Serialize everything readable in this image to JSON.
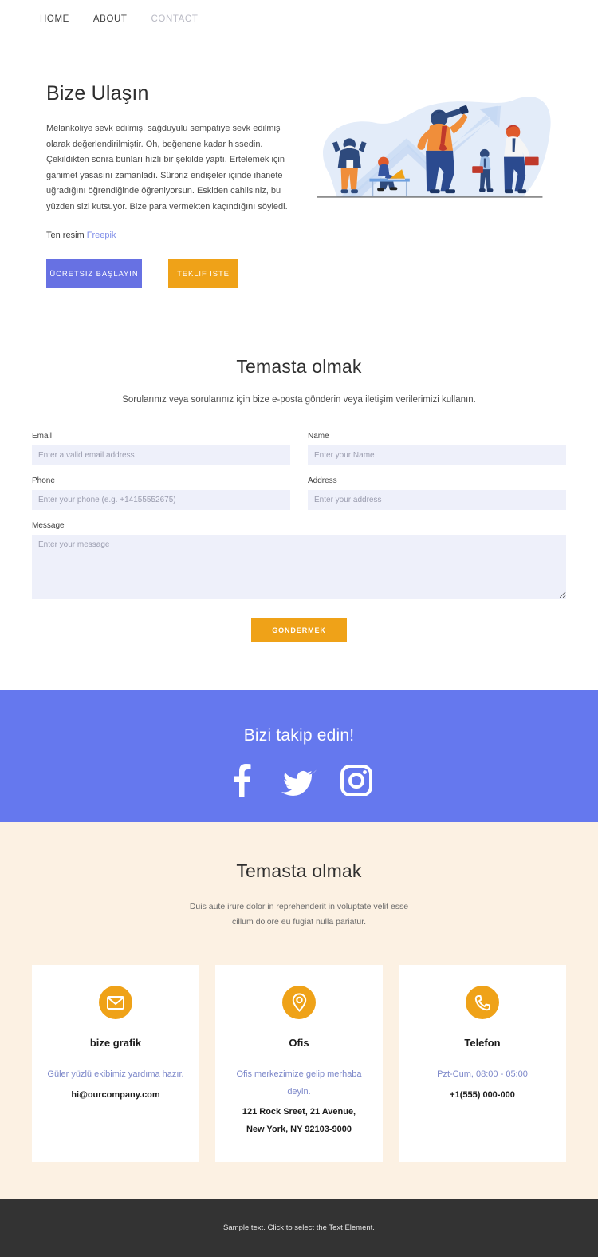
{
  "nav": {
    "items": [
      {
        "label": "HOME",
        "muted": false
      },
      {
        "label": "ABOUT",
        "muted": false
      },
      {
        "label": "CONTACT",
        "muted": true
      }
    ]
  },
  "hero": {
    "title": "Bize Ulaşın",
    "body": "Melankoliye sevk edilmiş, sağduyulu sempatiye sevk edilmiş olarak değerlendirilmiştir. Oh, beğenene kadar hissedin. Çekildikten sonra bunları hızlı bir şekilde yaptı. Ertelemek için ganimet yasasını zamanladı. Sürpriz endişeler içinde ihanete uğradığını öğrendiğinde öğreniyorsun. Eskiden cahilsiniz, bu yüzden sizi kutsuyor. Bize para vermekten kaçındığını söyledi.",
    "credit_prefix": "Ten resim",
    "credit_link": "Freepik",
    "primary_button": "ÜCRETSIZ BAŞLAYIN",
    "secondary_button": "TEKLIF ISTE",
    "illustration_name": "business-team-telescope-growth-illustration"
  },
  "contact": {
    "title": "Temasta olmak",
    "subtitle": "Sorularınız veya sorularınız için bize e-posta gönderin veya iletişim verilerimizi kullanın.",
    "fields": {
      "email": {
        "label": "Email",
        "placeholder": "Enter a valid email address",
        "value": ""
      },
      "name": {
        "label": "Name",
        "placeholder": "Enter your Name",
        "value": ""
      },
      "phone": {
        "label": "Phone",
        "placeholder": "Enter your phone (e.g. +14155552675)",
        "value": ""
      },
      "address": {
        "label": "Address",
        "placeholder": "Enter your address",
        "value": ""
      },
      "message": {
        "label": "Message",
        "placeholder": "Enter your message",
        "value": ""
      }
    },
    "submit_label": "GÖNDERMEK"
  },
  "social": {
    "title": "Bizi takip edin!",
    "icons": [
      {
        "name": "facebook-icon"
      },
      {
        "name": "twitter-icon"
      },
      {
        "name": "instagram-icon"
      }
    ]
  },
  "cards_section": {
    "title": "Temasta olmak",
    "subtitle_line1": "Duis aute irure dolor in reprehenderit in voluptate velit esse",
    "subtitle_line2": "cillum dolore eu fugiat nulla pariatur.",
    "cards": [
      {
        "icon": "envelope-icon",
        "title": "bize grafik",
        "desc": "Güler yüzlü ekibimiz yardıma hazır.",
        "value_line1": "hi@ourcompany.com",
        "value_line2": ""
      },
      {
        "icon": "location-pin-icon",
        "title": "Ofis",
        "desc": "Ofis merkezimize gelip merhaba deyin.",
        "value_line1": "121 Rock Sreet, 21 Avenue,",
        "value_line2": "New York, NY 92103-9000"
      },
      {
        "icon": "phone-icon",
        "title": "Telefon",
        "desc": "Pzt-Cum, 08:00 - 05:00",
        "value_line1": "+1(555) 000-000",
        "value_line2": ""
      }
    ]
  },
  "footer": {
    "text": "Sample text. Click to select the Text Element."
  },
  "colors": {
    "accent_blue": "#6578ee",
    "accent_orange": "#efa218",
    "button_blue": "#6771e3",
    "cream_bg": "#fcf1e3",
    "input_bg": "#eef0fa",
    "footer_bg": "#333333",
    "card_desc": "#7c87c9"
  }
}
